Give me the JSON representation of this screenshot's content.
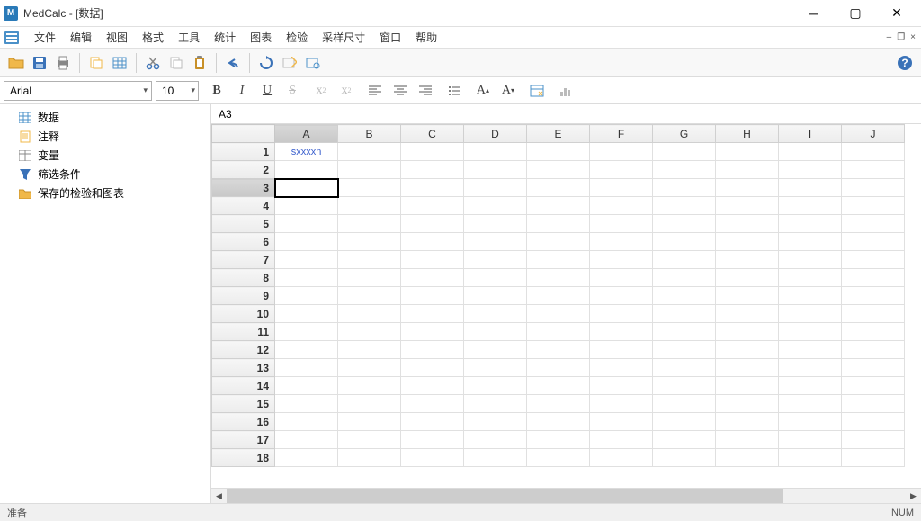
{
  "titlebar": {
    "app": "MedCalc",
    "doc": "[数据]"
  },
  "menu": {
    "items": [
      "文件",
      "编辑",
      "视图",
      "格式",
      "工具",
      "统计",
      "图表",
      "检验",
      "采样尺寸",
      "窗口",
      "帮助"
    ]
  },
  "format": {
    "font": "Arial",
    "size": "10"
  },
  "sidebar": {
    "items": [
      {
        "label": "数据"
      },
      {
        "label": "注释"
      },
      {
        "label": "变量"
      },
      {
        "label": "筛选条件"
      },
      {
        "label": "保存的检验和图表"
      }
    ]
  },
  "sheet": {
    "cell_ref": "A3",
    "columns": [
      "A",
      "B",
      "C",
      "D",
      "E",
      "F",
      "G",
      "H",
      "I",
      "J"
    ],
    "rows": [
      "1",
      "2",
      "3",
      "4",
      "5",
      "6",
      "7",
      "8",
      "9",
      "10",
      "11",
      "12",
      "13",
      "14",
      "15",
      "16",
      "17",
      "18"
    ],
    "a1_value": "sxxxxn",
    "selected": {
      "row": 3,
      "col": "A"
    }
  },
  "statusbar": {
    "left": "准备",
    "right": "NUM"
  }
}
